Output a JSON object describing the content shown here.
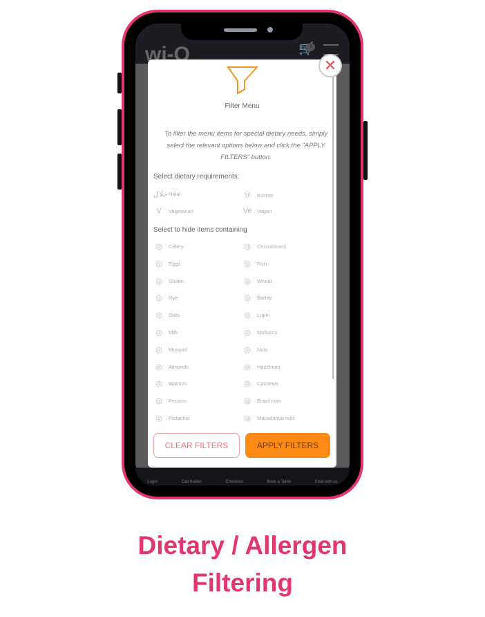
{
  "app": {
    "logo": "wi-Q",
    "cart_count": "1"
  },
  "modal": {
    "title": "Filter Menu",
    "intro": "To filter the menu items for special dietary needs, simply select the relevant options below and click the \"APPLY FILTERS\" button.",
    "dietary_heading": "Select dietary requirements:",
    "allergen_heading": "Select to hide items containing",
    "dietary": [
      {
        "label": "Halal",
        "icon": "حلال"
      },
      {
        "label": "Kosher",
        "icon": "Ⓤ"
      },
      {
        "label": "Vegetarian",
        "icon": "V"
      },
      {
        "label": "Vegan",
        "icon": "Ve"
      }
    ],
    "allergens": [
      "Celery",
      "Crustaceans",
      "Eggs",
      "Fish",
      "Gluten",
      "Wheat",
      "Rye",
      "Barley",
      "Oats",
      "Lupin",
      "Milk",
      "Molluscs",
      "Mustard",
      "Nuts",
      "Almonds",
      "Hazelnuts",
      "Walnuts",
      "Cashews",
      "Pecans",
      "Brazil nuts",
      "Pistachio",
      "Macadamia nuts"
    ],
    "clear_label": "CLEAR FILTERS",
    "apply_label": "APPLY FILTERS"
  },
  "footer": [
    "Login",
    "Call Waiter",
    "Checkout",
    "Book a Table",
    "Chat with us"
  ],
  "caption": {
    "line1": "Dietary / Allergen",
    "line2": "Filtering"
  },
  "colors": {
    "accent": "#e2376c",
    "apply": "#fd8a14"
  }
}
